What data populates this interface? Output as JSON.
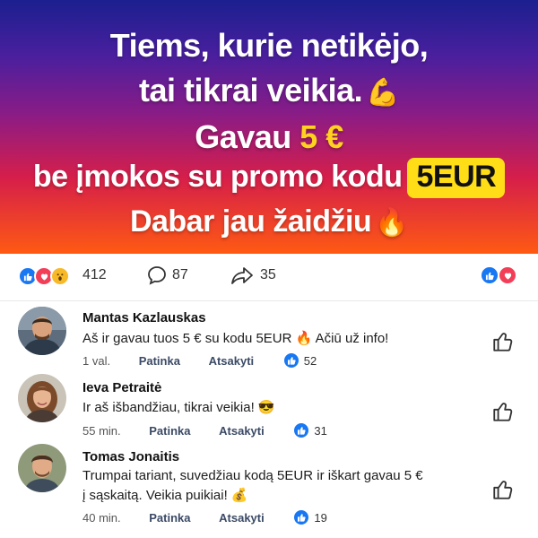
{
  "hero": {
    "line1": "Tiems, kurie netikėjo,",
    "line2": "tai tikrai veikia.",
    "line2_emoji": "💪",
    "line3_prefix": "Gavau ",
    "line3_amount": "5 €",
    "line4_prefix": "be įmokos su promo kodu",
    "promo_code": "5EUR",
    "line5": "Dabar jau žaidžiu",
    "line5_emoji": "🔥"
  },
  "stats": {
    "reactions": "412",
    "comments": "87",
    "shares": "35",
    "reaction_icons": [
      "like-icon",
      "love-icon",
      "wow-icon"
    ]
  },
  "comments": [
    {
      "name": "Mantas Kazlauskas",
      "text": "Aš ir gavau tuos 5 € su kodu 5EUR 🔥 Ačiū už info!",
      "time": "1 val.",
      "like_label": "Patinka",
      "reply_label": "Atsakyti",
      "likes": "52"
    },
    {
      "name": "Ieva Petraitė",
      "text": "Ir aš išbandžiau, tikrai veikia! 😎",
      "time": "55 min.",
      "like_label": "Patinka",
      "reply_label": "Atsakyti",
      "likes": "31"
    },
    {
      "name": "Tomas Jonaitis",
      "text": "Trumpai tariant, suvedžiau kodą 5EUR ir iškart gavau 5 € į sąskaitą. Veikia puikiai! 💰",
      "time": "40 min.",
      "like_label": "Patinka",
      "reply_label": "Atsakyti",
      "likes": "19"
    }
  ],
  "colors": {
    "facebook_blue": "#1877f2",
    "love_red": "#f33e58",
    "promo_yellow": "#ffde17",
    "amount_yellow": "#ffd21f"
  }
}
